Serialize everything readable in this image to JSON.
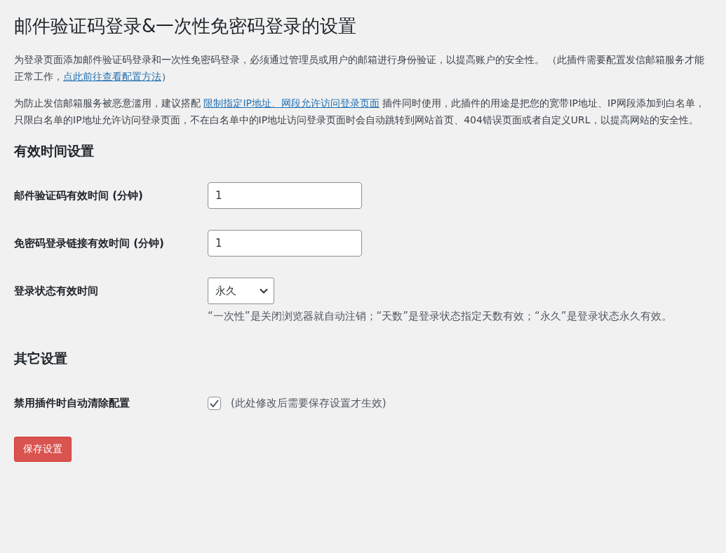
{
  "title": "邮件验证码登录&一次性免密码登录的设置",
  "intro": [
    [
      {
        "kind": "text",
        "text": "为登录页面添加邮件验证码登录和一次性免密码登录，必须通过管理员或用户的邮箱进行身份验证，以提高账户的安全性。 （此插件需要配置发信邮箱服务才能正常工作，"
      },
      {
        "kind": "link",
        "text": "点此前往查看配置方法"
      },
      {
        "kind": "text",
        "text": "）"
      }
    ],
    [
      {
        "kind": "text",
        "text": "为防止发信邮箱服务被恶意滥用，建议搭配 "
      },
      {
        "kind": "link",
        "text": "限制指定IP地址、网段允许访问登录页面"
      },
      {
        "kind": "text",
        "text": " 插件同时使用，此插件的用途是把您的宽带IP地址、IP网段添加到白名单，只限白名单的IP地址允许访问登录页面，不在白名单中的IP地址访问登录页面时会自动跳转到网站首页、404错误页面或者自定义URL，以提高网站的安全性。"
      }
    ]
  ],
  "sections": [
    {
      "heading": "有效时间设置",
      "fields": [
        {
          "kind": "number",
          "label": "邮件验证码有效时间 (分钟)",
          "value": "1"
        },
        {
          "kind": "number",
          "label": "免密码登录链接有效时间 (分钟)",
          "value": "1"
        },
        {
          "kind": "select",
          "label": "登录状态有效时间",
          "value": "永久",
          "description": "“一次性”是关闭浏览器就自动注销；“天数”是登录状态指定天数有效；“永久”是登录状态永久有效。"
        }
      ]
    },
    {
      "heading": "其它设置",
      "fields": [
        {
          "kind": "checkbox",
          "label": "禁用插件时自动清除配置",
          "checked": true,
          "description": "(此处修改后需要保存设置才生效)"
        }
      ]
    }
  ],
  "save_button": "保存设置"
}
